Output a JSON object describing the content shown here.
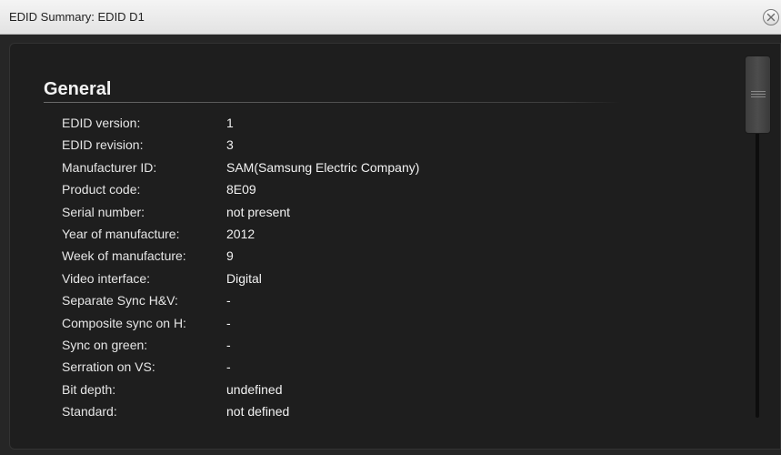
{
  "window": {
    "title": "EDID Summary: EDID D1"
  },
  "icons": {
    "close": "close-circle-icon",
    "grip": "scroll-grip-icon"
  },
  "section": {
    "title": "General"
  },
  "rows": [
    {
      "label": "EDID version:",
      "value": "1"
    },
    {
      "label": "EDID revision:",
      "value": "3"
    },
    {
      "label": "Manufacturer ID:",
      "value": "SAM(Samsung Electric Company)"
    },
    {
      "label": "Product code:",
      "value": "8E09"
    },
    {
      "label": "Serial number:",
      "value": "not present"
    },
    {
      "label": "Year of manufacture:",
      "value": "2012"
    },
    {
      "label": "Week of manufacture:",
      "value": "9"
    },
    {
      "label": "Video interface:",
      "value": "Digital"
    },
    {
      "label": "Separate Sync H&V:",
      "value": "-"
    },
    {
      "label": "Composite sync on H:",
      "value": "-"
    },
    {
      "label": "Sync on green:",
      "value": "-"
    },
    {
      "label": "Serration on VS:",
      "value": "-"
    },
    {
      "label": "Bit depth:",
      "value": "undefined"
    },
    {
      "label": "Standard:",
      "value": "not defined"
    }
  ],
  "colors": {
    "titlebar": "#eaeaea",
    "panel": "#1e1e1e",
    "text": "#f2f2f2"
  }
}
